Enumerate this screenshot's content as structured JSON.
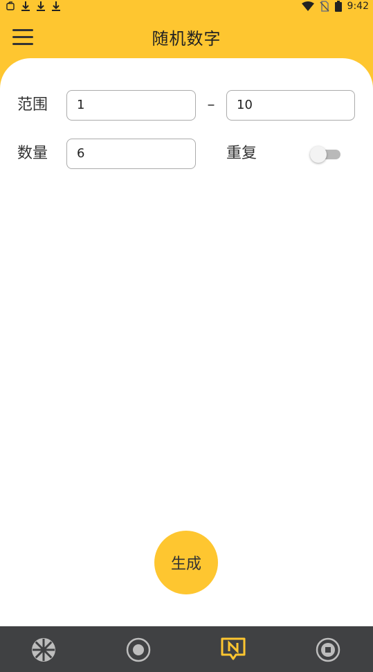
{
  "status_bar": {
    "time": "9:42",
    "left_icons": [
      "notification-icon",
      "download-icon",
      "download-icon",
      "download-icon"
    ],
    "right_icons": [
      "wifi-icon",
      "no-sim-icon",
      "battery-icon"
    ]
  },
  "header": {
    "title": "随机数字",
    "menu_icon": "menu-icon",
    "accent_color": "#fec630"
  },
  "form": {
    "range_label": "范围",
    "range_min": "1",
    "range_separator": "–",
    "range_max": "10",
    "count_label": "数量",
    "count_value": "6",
    "repeat_label": "重复",
    "repeat_enabled": false
  },
  "generate_button": "生成",
  "bottom_nav": {
    "background": "#404143",
    "active_color": "#fec630",
    "items": [
      {
        "icon": "wheel-icon",
        "active": false
      },
      {
        "icon": "dice-icon",
        "active": false
      },
      {
        "icon": "number-n-icon",
        "active": true
      },
      {
        "icon": "coin-icon",
        "active": false
      }
    ]
  }
}
